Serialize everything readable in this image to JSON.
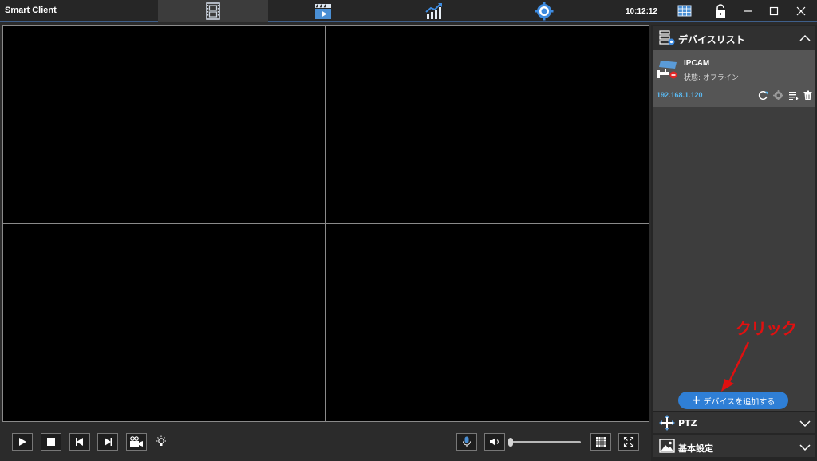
{
  "titlebar": {
    "app_title": "Smart Client",
    "clock": "10:12:12",
    "nav_tabs": [
      {
        "icon": "film-strip-icon",
        "active": true
      },
      {
        "icon": "playback-icon",
        "active": false
      },
      {
        "icon": "statistics-chart-icon",
        "active": false
      },
      {
        "icon": "settings-gear-icon",
        "active": false
      }
    ],
    "window_controls": [
      "screen-layout-icon",
      "unlock-icon",
      "minimize-icon",
      "maximize-icon",
      "close-icon"
    ]
  },
  "video_grid": {
    "rows": 2,
    "cols": 2,
    "background": "#000000"
  },
  "toolbar": {
    "left_buttons": [
      "play-icon",
      "stop-icon",
      "prev-frame-icon",
      "next-frame-icon",
      "record-camera-icon",
      "light-bulb-icon"
    ],
    "right_buttons": [
      "microphone-icon",
      "speaker-icon",
      "grid-layout-icon",
      "fullscreen-icon"
    ],
    "volume_level": 0
  },
  "device_panel": {
    "title": "デバイスリスト",
    "device": {
      "name": "IPCAM",
      "status": "状態: オフライン",
      "ip": "192.168.1.120",
      "actions": [
        "refresh-icon",
        "device-settings-icon",
        "details-list-icon",
        "delete-trash-icon"
      ]
    },
    "add_button_label": "デバイスを追加する",
    "sections": [
      {
        "label": "PTZ",
        "icon": "ptz-move-icon"
      },
      {
        "label": "基本設定",
        "icon": "image-settings-icon"
      }
    ]
  },
  "annotation": {
    "text": "クリック",
    "color": "#e01010"
  },
  "colors": {
    "accent": "#2f7fd6",
    "ip_text": "#5ab8f0",
    "titlebar_underline": "#3f5f8a"
  }
}
